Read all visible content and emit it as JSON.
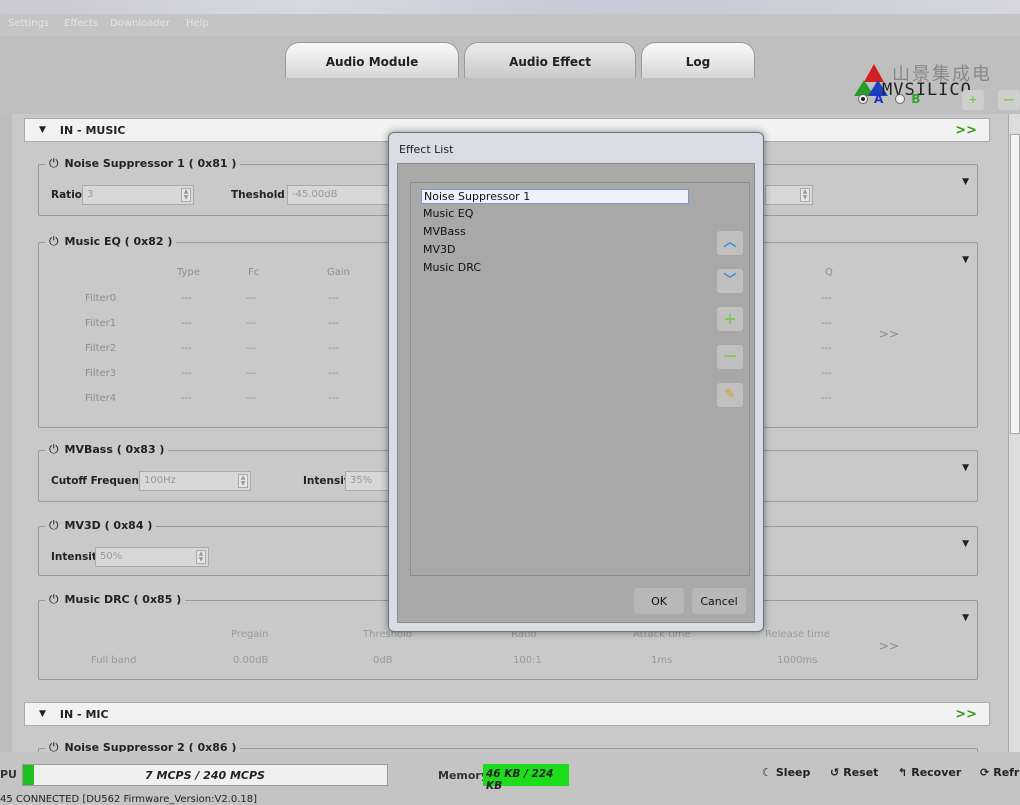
{
  "menu": [
    "Settings",
    "Effects",
    "Downloader",
    "Help"
  ],
  "tabs": [
    {
      "label": "Audio Module",
      "active": false
    },
    {
      "label": "Audio Effect",
      "active": true
    },
    {
      "label": "Log",
      "active": false
    }
  ],
  "logo": {
    "cn": "山景集成电",
    "en": "MVSILICO"
  },
  "ab": {
    "a": "A",
    "b": "B",
    "selected": "A"
  },
  "in_music": {
    "title": "IN - MUSIC"
  },
  "ns1": {
    "title": "Noise Suppressor 1 ( 0x81 )",
    "ratio_label": "Ratio",
    "ratio_value": "3",
    "thresh_label": "Theshold",
    "thresh_value": "-45.00dB"
  },
  "eq": {
    "title": "Music EQ ( 0x82 )",
    "headers": [
      "Type",
      "Fc",
      "Gain",
      "Q"
    ],
    "filters": [
      "Filter0",
      "Filter1",
      "Filter2",
      "Filter3",
      "Filter4"
    ],
    "empty": "---"
  },
  "bass": {
    "title": "MVBass ( 0x83 )",
    "cutoff_label": "Cutoff Frequency",
    "cutoff_value": "100Hz",
    "intensity_label": "Intensity",
    "intensity_value": "35%"
  },
  "mv3d": {
    "title": "MV3D ( 0x84 )",
    "intensity_label": "Intensity",
    "intensity_value": "50%"
  },
  "drc": {
    "title": "Music DRC ( 0x85 )",
    "headers": [
      "Pregain",
      "Threshold",
      "Ratio",
      "Attack time",
      "Release time"
    ],
    "row_label": "Full band",
    "values": [
      "0.00dB",
      "0dB",
      "100:1",
      "1ms",
      "1000ms"
    ]
  },
  "in_mic": {
    "title": "IN - MIC"
  },
  "ns2": {
    "title": "Noise Suppressor 2 ( 0x86 )"
  },
  "dialog": {
    "title": "Effect List",
    "items": [
      "Noise Suppressor 1",
      "Music EQ",
      "MVBass",
      "MV3D",
      "Music DRC"
    ],
    "selected_index": 0,
    "ok": "OK",
    "cancel": "Cancel"
  },
  "status": {
    "cpu_label": "PU",
    "cpu_text": "7 MCPS / 240 MCPS",
    "cpu_fraction": 0.029,
    "mem_label": "Memory",
    "mem_text": "46 KB / 224 KB",
    "sleep": "Sleep",
    "reset": "Reset",
    "recover": "Recover",
    "refresh": "Refre",
    "connection": "45 CONNECTED [DU562 Firmware_Version:V2.0.18]"
  },
  "colors": {
    "accent_green": "#1fc01f",
    "arrow_green": "#3a9a1a",
    "blue_text": "#1a2fd0"
  }
}
